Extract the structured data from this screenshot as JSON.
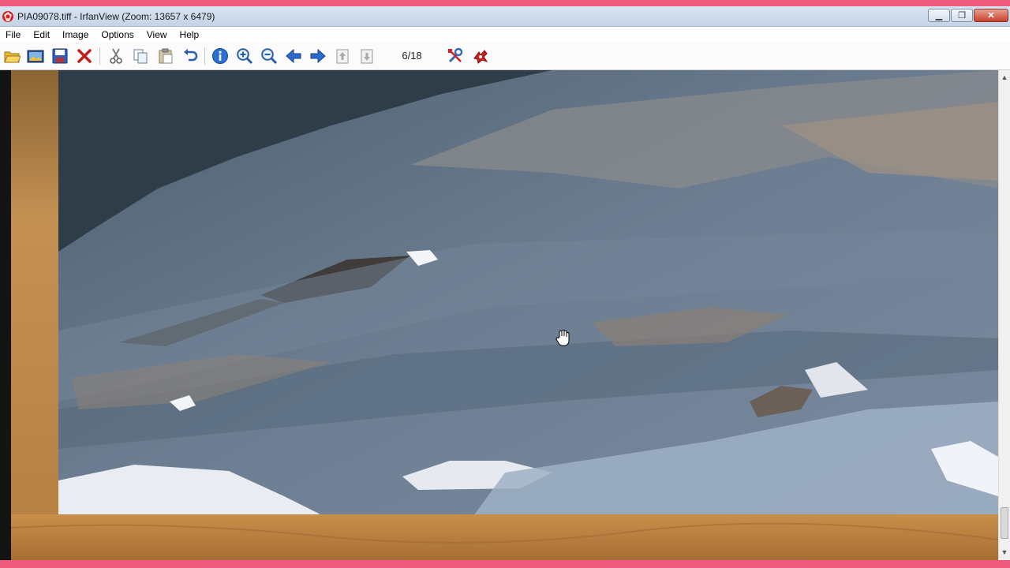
{
  "window": {
    "title": "PIA09078.tiff - IrfanView (Zoom: 13657 x 6479)",
    "accent": "#ef5b7c"
  },
  "menu": [
    "File",
    "Edit",
    "Image",
    "Options",
    "View",
    "Help"
  ],
  "toolbar": {
    "buttons": [
      {
        "name": "open-icon"
      },
      {
        "name": "thumbnails-icon"
      },
      {
        "name": "save-icon"
      },
      {
        "name": "delete-icon"
      },
      {
        "name": "cut-icon"
      },
      {
        "name": "copy-icon"
      },
      {
        "name": "paste-icon"
      },
      {
        "name": "undo-icon"
      },
      {
        "name": "info-icon"
      },
      {
        "name": "zoom-in-icon"
      },
      {
        "name": "zoom-out-icon"
      },
      {
        "name": "previous-icon"
      },
      {
        "name": "next-icon"
      },
      {
        "name": "first-icon"
      },
      {
        "name": "last-icon"
      },
      {
        "name": "settings-icon"
      },
      {
        "name": "irfanview-icon"
      }
    ],
    "page_counter": "6/18"
  },
  "viewer": {
    "cursor": "hand-cursor-icon",
    "image_description_colors": {
      "sand": "#c9904f",
      "rock_blue": "#6e7f94",
      "dark_rock": "#4d5a66"
    }
  },
  "scrollbar": {
    "up": "up-arrow-icon",
    "down": "down-arrow-icon"
  }
}
